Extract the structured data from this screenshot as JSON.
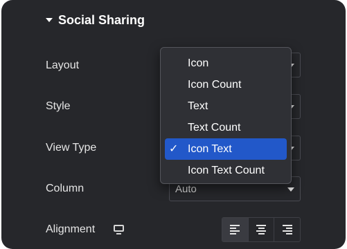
{
  "section": {
    "title": "Social Sharing",
    "expanded": true
  },
  "rows": {
    "layout": {
      "label": "Layout"
    },
    "style": {
      "label": "Style"
    },
    "view_type": {
      "label": "View Type"
    },
    "column": {
      "label": "Column",
      "value": "Auto"
    },
    "alignment": {
      "label": "Alignment",
      "device_icon": "desktop-icon",
      "options": [
        "align-left-icon",
        "align-center-icon",
        "align-right-icon"
      ],
      "selected": "align-left-icon"
    }
  },
  "dropdown": {
    "options": [
      "Icon",
      "Icon Count",
      "Text",
      "Text Count",
      "Icon Text",
      "Icon Text Count"
    ],
    "selected": "Icon Text",
    "check_mark": "✓"
  },
  "colors": {
    "panel": "#26272b",
    "selected": "#2258c9",
    "text": "#ffffff"
  }
}
